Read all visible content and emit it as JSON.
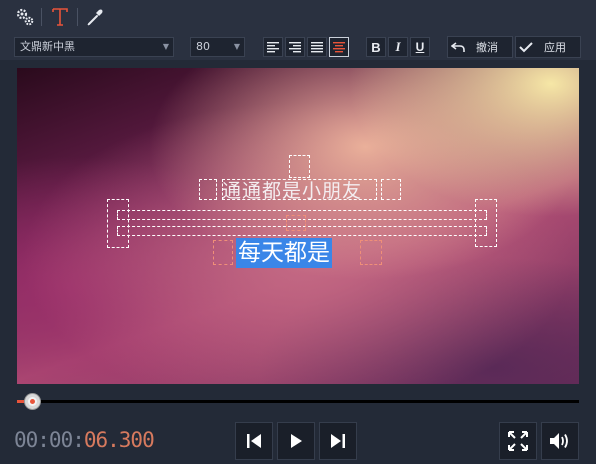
{
  "toolbar": {
    "icons": [
      "gears-icon",
      "text-icon",
      "eyedropper-icon"
    ]
  },
  "format": {
    "font_name": "文鼎新中黑",
    "font_size": "80",
    "undo_label": "撤消",
    "apply_label": "应用",
    "bold_label": "B",
    "italic_label": "I",
    "underline_label": "U"
  },
  "preview": {
    "text_line1": "通通都是小朋友",
    "text_line2": "每天都是"
  },
  "playback": {
    "time_prefix": "00:00:",
    "time_current": "06.300",
    "progress": 0.027
  },
  "colors": {
    "accent": "#e8543a",
    "selection": "#3a86e8",
    "time_current": "#d77a5e"
  }
}
